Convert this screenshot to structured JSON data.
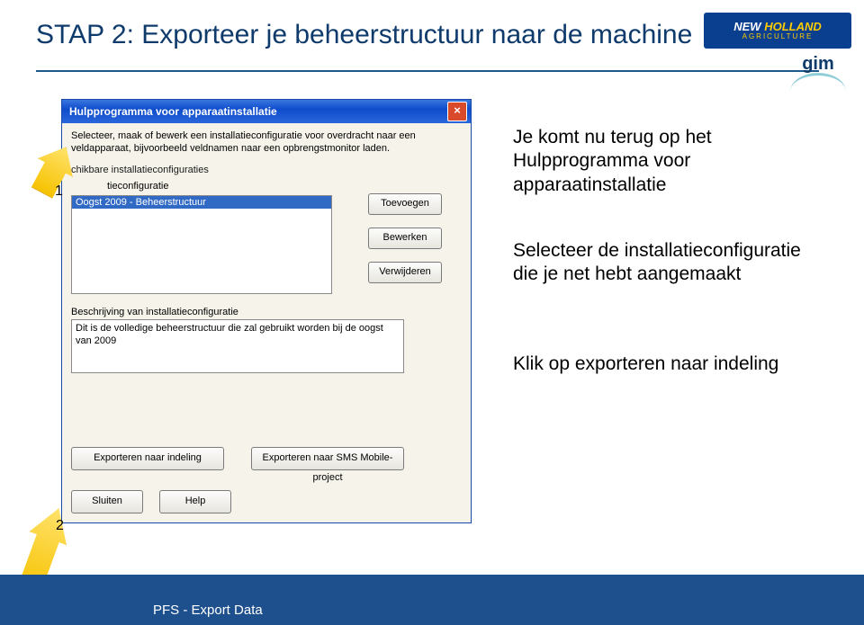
{
  "slide": {
    "title": "STAP 2: Exporteer je beheerstructuur naar de machine"
  },
  "logos": {
    "brand_new": "NEW",
    "brand_holland": " HOLLAND",
    "brand_sub": "AGRICULTURE",
    "gim": "gim"
  },
  "dialog": {
    "title": "Hulpprogramma voor apparaatinstallatie",
    "instructions": "Selecteer, maak of bewerk een installatieconfiguratie voor overdracht naar een veldapparaat, bijvoorbeeld veldnamen naar een opbrengstmonitor laden.",
    "configs_label": "chikbare installatieconfiguraties",
    "sublabel": "tieconfiguratie",
    "selected_config": "Oogst 2009 - Beheerstructuur",
    "btn_add": "Toevoegen",
    "btn_edit": "Bewerken",
    "btn_delete": "Verwijderen",
    "desc_label": "Beschrijving van installatieconfiguratie",
    "desc_text": "Dit is de volledige beheerstructuur die zal gebruikt worden bij de oogst van 2009",
    "btn_export_format": "Exporteren naar indeling",
    "btn_export_sms": "Exporteren naar SMS Mobile-project",
    "btn_close": "Sluiten",
    "btn_help": "Help"
  },
  "annotations": {
    "a1": "Je komt nu terug op het Hulpprogramma voor apparaatinstallatie",
    "a2": "Selecteer de installatieconfiguratie die je net hebt aangemaakt",
    "a3": "Klik op exporteren naar indeling"
  },
  "arrows": {
    "num1": "1",
    "num2": "2"
  },
  "footer": {
    "text": "PFS  -  Export Data"
  }
}
